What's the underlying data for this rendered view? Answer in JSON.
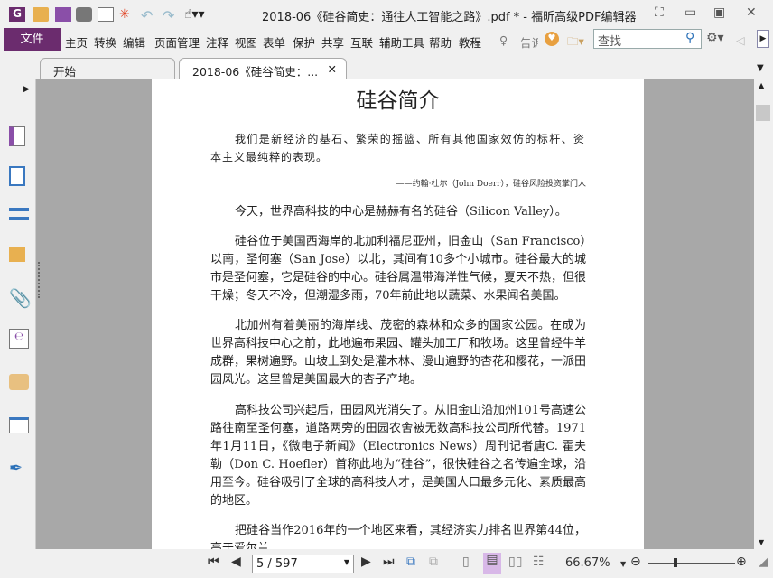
{
  "window": {
    "title": "2018-06《硅谷简史：通往人工智能之路》.pdf * - 福昕高级PDF编辑器"
  },
  "menu": {
    "file": "文件",
    "items": [
      "主页",
      "转换",
      "编辑",
      "页面管理",
      "注释",
      "视图",
      "表单",
      "保护",
      "共享",
      "互联",
      "辅助工具",
      "帮助",
      "教程"
    ],
    "tell": "告诉",
    "search_placeholder": "查找"
  },
  "tabs": [
    {
      "label": "开始"
    },
    {
      "label": "2018-06《硅谷简史：..."
    }
  ],
  "page": {
    "title": "硅谷简介",
    "quote": "我们是新经济的基石、繁荣的摇篮、所有其他国家效仿的标杆、资本主义最纯粹的表现。",
    "attribution": "——约翰·杜尔（John Doerr），硅谷风险投资掌门人",
    "paragraphs": [
      "今天，世界高科技的中心是赫赫有名的硅谷（Silicon Valley）。",
      "硅谷位于美国西海岸的北加利福尼亚州，旧金山（San Francisco）以南，圣何塞（San Jose）以北，其间有10多个小城市。硅谷最大的城市是圣何塞，它是硅谷的中心。硅谷属温带海洋性气候，夏天不热，但很干燥；冬天不冷，但潮湿多雨，70年前此地以蔬菜、水果闻名美国。",
      "北加州有着美丽的海岸线、茂密的森林和众多的国家公园。在成为世界高科技中心之前，此地遍布果园、罐头加工厂和牧场。这里曾经牛羊成群，果树遍野。山坡上到处是灌木林、漫山遍野的杏花和樱花，一派田园风光。这里曾是美国最大的杏子产地。",
      "高科技公司兴起后，田园风光消失了。从旧金山沿加州101号高速公路往南至圣何塞，道路两旁的田园农舍被无数高科技公司所代替。1971年1月11日，《微电子新闻》（Electronics News）周刊记者唐C. 霍夫勒（Don C. Hoefler）首称此地为“硅谷”，很快硅谷之名传遍全球，沿用至今。硅谷吸引了全球的高科技人才，是美国人口最多元化、素质最高的地区。",
      "把硅谷当作2016年的一个地区来看，其经济实力排名世界第44位，高于爱尔兰"
    ]
  },
  "status": {
    "page": "5 / 597",
    "zoom": "66.67%"
  },
  "colors": {
    "brand": "#6b2c6e"
  }
}
